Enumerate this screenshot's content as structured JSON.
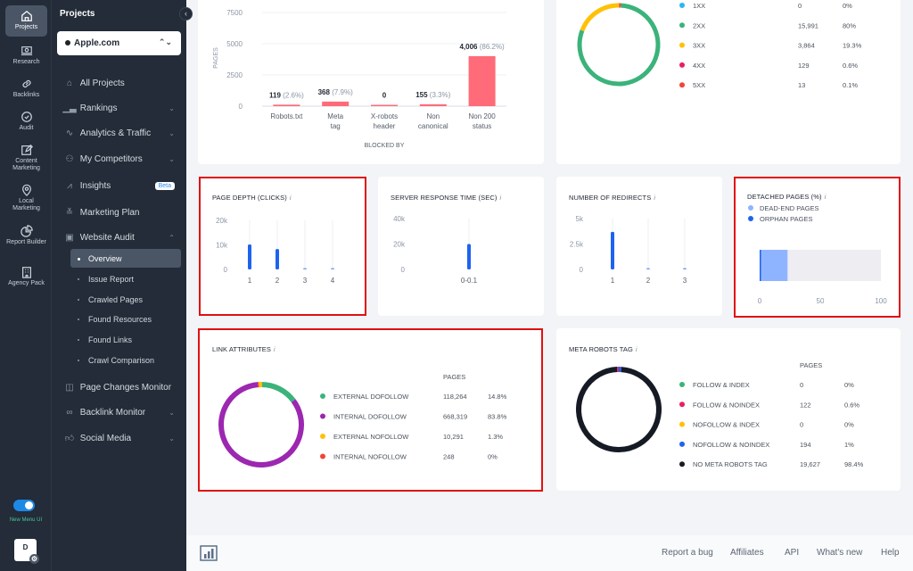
{
  "rail": [
    {
      "label": "Projects",
      "icon": "home-icon",
      "active": true
    },
    {
      "label": "Research",
      "icon": "laptop-search-icon"
    },
    {
      "label": "Backlinks",
      "icon": "link-icon"
    },
    {
      "label": "Audit",
      "icon": "check-circle-icon"
    },
    {
      "label": "Content Marketing",
      "icon": "edit-icon"
    },
    {
      "label": "Local Marketing",
      "icon": "map-pin-icon"
    },
    {
      "label": "Report Builder",
      "icon": "pie-chart-icon"
    },
    {
      "label": "Agency Pack",
      "icon": "building-icon"
    }
  ],
  "panel": {
    "title": "Projects",
    "project": "Apple.com",
    "items": [
      {
        "label": "All Projects",
        "icon": "home-icon"
      },
      {
        "label": "Rankings",
        "icon": "bar-icon",
        "chevron": "down"
      },
      {
        "label": "Analytics & Traffic",
        "icon": "pulse-icon",
        "chevron": "down"
      },
      {
        "label": "My Competitors",
        "icon": "competitors-icon",
        "chevron": "down"
      },
      {
        "label": "Insights",
        "icon": "trend-icon",
        "badge": "Beta"
      },
      {
        "label": "Marketing Plan",
        "icon": "plan-icon"
      },
      {
        "label": "Website Audit",
        "icon": "audit-icon",
        "chevron": "up"
      },
      {
        "label": "Page Changes Monitor",
        "icon": "columns-icon"
      },
      {
        "label": "Backlink Monitor",
        "icon": "link-icon",
        "chevron": "down"
      },
      {
        "label": "Social Media",
        "icon": "thumbs-up-icon",
        "chevron": "down"
      }
    ],
    "subitems": [
      "Overview",
      "Issue Report",
      "Crawled Pages",
      "Found Resources",
      "Found Links",
      "Crawl Comparison"
    ],
    "active_sub": "Overview"
  },
  "toggle": {
    "label": "New Menu UI",
    "on": true
  },
  "avatar": {
    "initial": "D"
  },
  "footer": {
    "links": [
      "Report a bug",
      "Affiliates",
      "API",
      "What's new",
      "Help"
    ]
  },
  "chart_data": [
    {
      "id": "blocked-by",
      "type": "bar",
      "title": "",
      "xlabel": "BLOCKED BY",
      "ylabel": "PAGES",
      "ylim": [
        0,
        7500
      ],
      "yticks": [
        "0",
        "2500",
        "5000",
        "7500"
      ],
      "categories": [
        "Robots.txt",
        "Meta tag",
        "X-robots header",
        "Non canonical",
        "Non 200 status"
      ],
      "values": [
        119,
        368,
        0,
        155,
        4006
      ],
      "labels": [
        {
          "v": "119",
          "p": "(2.6%)"
        },
        {
          "v": "368",
          "p": "(7.9%)"
        },
        {
          "v": "0",
          "p": ""
        },
        {
          "v": "155",
          "p": "(3.3%)"
        },
        {
          "v": "4,006",
          "p": "(86.2%)"
        }
      ],
      "color": "#ff6b78"
    },
    {
      "id": "status-codes",
      "type": "pie",
      "series": [
        {
          "name": "1XX",
          "value": 0,
          "display": "0",
          "pct": "0%",
          "color": "#29b6f6"
        },
        {
          "name": "2XX",
          "value": 15991,
          "display": "15,991",
          "pct": "80%",
          "color": "#3bb37b"
        },
        {
          "name": "3XX",
          "value": 3864,
          "display": "3,864",
          "pct": "19.3%",
          "color": "#ffc107"
        },
        {
          "name": "4XX",
          "value": 129,
          "display": "129",
          "pct": "0.6%",
          "color": "#e91e63"
        },
        {
          "name": "5XX",
          "value": 13,
          "display": "13",
          "pct": "0.1%",
          "color": "#f44336"
        }
      ]
    },
    {
      "id": "page-depth",
      "type": "bar",
      "title": "PAGE DEPTH (CLICKS)",
      "ylim": [
        0,
        20000
      ],
      "yticks": [
        "0",
        "10k",
        "20k"
      ],
      "categories": [
        "1",
        "2",
        "3",
        "4"
      ],
      "values": [
        10200,
        8300,
        300,
        250
      ],
      "color": "#1e63f0"
    },
    {
      "id": "server-response",
      "type": "bar",
      "title": "SERVER RESPONSE TIME (SEC)",
      "ylim": [
        0,
        40000
      ],
      "yticks": [
        "0",
        "20k",
        "40k"
      ],
      "categories": [
        "0-0.1"
      ],
      "values": [
        20000
      ],
      "color": "#1e63f0"
    },
    {
      "id": "redirects",
      "type": "bar",
      "title": "NUMBER OF REDIRECTS",
      "ylim": [
        0,
        5000
      ],
      "yticks": [
        "0",
        "2.5k",
        "5k"
      ],
      "categories": [
        "1",
        "2",
        "3"
      ],
      "values": [
        3700,
        60,
        60
      ],
      "color": "#1e63f0"
    },
    {
      "id": "detached-pages",
      "type": "bar",
      "title": "DETACHED PAGES (%)",
      "xlim": [
        0,
        100
      ],
      "xticks": [
        "0",
        "50",
        "100"
      ],
      "series": [
        {
          "name": "DEAD-END PAGES",
          "value": 23,
          "color": "#8fb4ff"
        },
        {
          "name": "ORPHAN PAGES",
          "value": 1,
          "color": "#1e63f0"
        }
      ]
    },
    {
      "id": "link-attributes",
      "type": "pie",
      "title": "LINK ATTRIBUTES",
      "column": "PAGES",
      "series": [
        {
          "name": "EXTERNAL DOFOLLOW",
          "value": 118264,
          "display": "118,264",
          "pct": "14.8%",
          "color": "#3bb37b"
        },
        {
          "name": "INTERNAL DOFOLLOW",
          "value": 668319,
          "display": "668,319",
          "pct": "83.8%",
          "color": "#9c27b0"
        },
        {
          "name": "EXTERNAL NOFOLLOW",
          "value": 10291,
          "display": "10,291",
          "pct": "1.3%",
          "color": "#ffc107"
        },
        {
          "name": "INTERNAL NOFOLLOW",
          "value": 248,
          "display": "248",
          "pct": "0%",
          "color": "#f44336"
        }
      ]
    },
    {
      "id": "meta-robots",
      "type": "pie",
      "title": "META ROBOTS TAG",
      "column": "PAGES",
      "series": [
        {
          "name": "FOLLOW & INDEX",
          "value": 0,
          "display": "0",
          "pct": "0%",
          "color": "#3bb37b"
        },
        {
          "name": "FOLLOW & NOINDEX",
          "value": 122,
          "display": "122",
          "pct": "0.6%",
          "color": "#e91e63"
        },
        {
          "name": "NOFOLLOW & INDEX",
          "value": 0,
          "display": "0",
          "pct": "0%",
          "color": "#ffc107"
        },
        {
          "name": "NOFOLLOW & NOINDEX",
          "value": 194,
          "display": "194",
          "pct": "1%",
          "color": "#1e63f0"
        },
        {
          "name": "NO META ROBOTS TAG",
          "value": 19627,
          "display": "19,627",
          "pct": "98.4%",
          "color": "#161a24"
        }
      ]
    }
  ]
}
